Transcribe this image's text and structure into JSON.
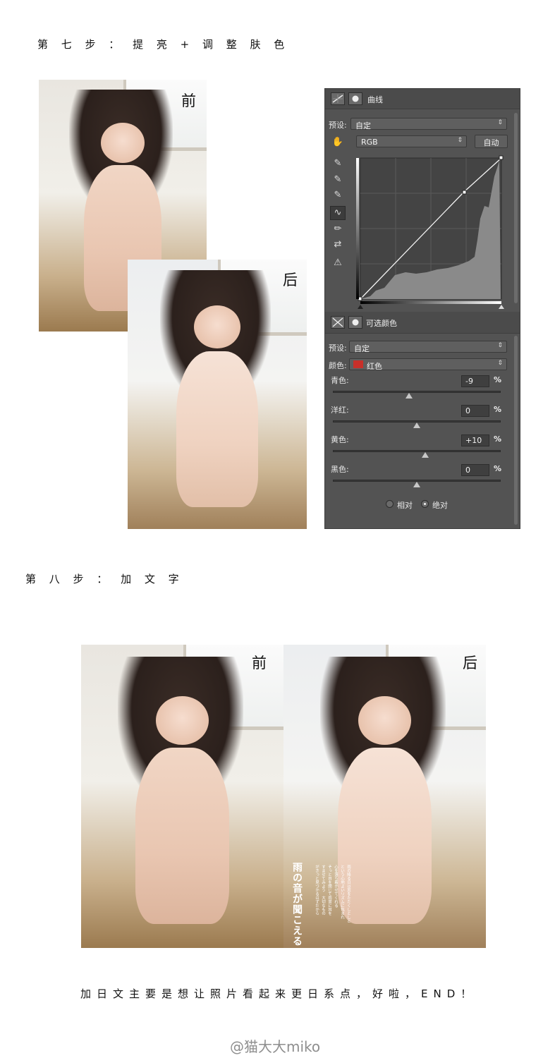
{
  "step7": {
    "title": "第 七 步 ： 提 亮 + 调 整 肤 色"
  },
  "step7_photos": {
    "before_label": "前",
    "after_label": "后"
  },
  "curves": {
    "title": "曲线",
    "preset_label": "预设:",
    "preset_value": "自定",
    "channel_value": "RGB",
    "auto_label": "自动"
  },
  "selective_color": {
    "title": "可选颜色",
    "preset_label": "预设:",
    "preset_value": "自定",
    "color_label": "颜色:",
    "color_value": "红色",
    "swatch_color": "#c8302a",
    "sliders": [
      {
        "label": "青色:",
        "value": "-9",
        "unit": "%",
        "level": -9
      },
      {
        "label": "洋红:",
        "value": "0",
        "unit": "%",
        "level": 0
      },
      {
        "label": "黄色:",
        "value": "+10",
        "unit": "%",
        "level": 10
      },
      {
        "label": "黑色:",
        "value": "0",
        "unit": "%",
        "level": 0
      }
    ],
    "relative_label": "相对",
    "absolute_label": "绝对",
    "method": "absolute"
  },
  "step8": {
    "title": "第 八 步 ： 加 文 字"
  },
  "step8_photos": {
    "before_label": "前",
    "after_label": "后",
    "jp_title": "雨の音が聞こえる",
    "jp_body_lines": [
      "雨の降る日は窓をたたくしとしと",
      "という心地よいリズムに包まれ",
      "心を落ち着かせてくれる",
      "そっと目を閉じて雨音に耳を",
      "すませてみよう　大切なもの",
      "がきっと見つかるはずだから"
    ]
  },
  "caption": "加日文主要是想让照片看起来更日系点，好啦，END！",
  "watermark": "@猫大大miko"
}
